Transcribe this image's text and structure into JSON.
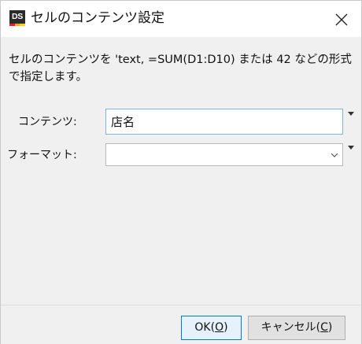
{
  "window": {
    "logo_text": "DS",
    "title": "セルのコンテンツ設定"
  },
  "description": "セルのコンテンツを 'text, =SUM(D1:D10) または 42 などの形式で指定します。",
  "form": {
    "contents_label": "コンテンツ:",
    "contents_value": "店名",
    "format_label": "フォーマット:",
    "format_value": ""
  },
  "buttons": {
    "ok_prefix": "OK(",
    "ok_key": "O",
    "ok_suffix": ")",
    "cancel_prefix": "キャンセル(",
    "cancel_key": "C",
    "cancel_suffix": ")"
  },
  "colors": {
    "focus_border": "#7fb3e3",
    "default_button_border": "#0078d7",
    "logo_stripes": [
      "#e11f26",
      "#f5a623",
      "#f7d417"
    ]
  }
}
